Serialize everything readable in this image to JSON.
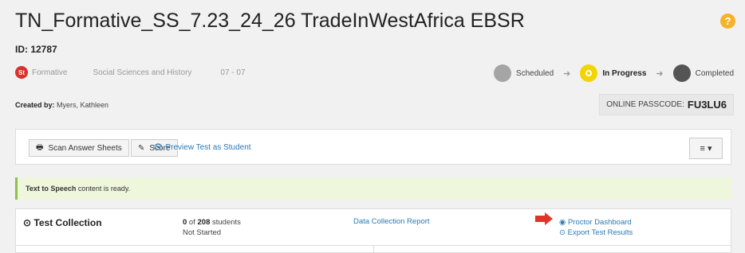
{
  "header": {
    "title": "TN_Formative_SS_7.23_24_26 TradeInWestAfrica EBSR",
    "help_icon": "question-circle-icon",
    "id_text": "ID: 12787"
  },
  "meta": {
    "badge": "St",
    "type": "Formative",
    "subject": "Social Sciences and History",
    "grade": "07 - 07"
  },
  "status_steps": [
    {
      "label": "Scheduled",
      "color": "#a5a5a5"
    },
    {
      "label": "In Progress",
      "color": "#f2d400",
      "active": true
    },
    {
      "label": "Completed",
      "color": "#555555"
    }
  ],
  "created": {
    "label": "Created by:",
    "name": "Myers, Kathleen"
  },
  "passcode": {
    "label": "ONLINE PASSCODE:",
    "code": "FU3LU6"
  },
  "toolbar": {
    "scan_label": "Scan Answer Sheets",
    "score_label": "Score",
    "preview_label": "Preview Test as Student",
    "menu_icon": "hamburger-menu-icon"
  },
  "notice": {
    "bold": "Text to Speech",
    "rest": " content is ready."
  },
  "collection": {
    "title": "Test Collection",
    "count": "0",
    "of_text": " of ",
    "total": "208",
    "students_suffix": " students",
    "status": "Not Started",
    "report_link": "Data Collection Report",
    "proctor_link": "Proctor Dashboard",
    "export_link": "Export Test Results"
  },
  "colors": {
    "accent_link": "#2a7ab8",
    "notice_bg": "#eef6dc",
    "help_icon": "#f5b32c",
    "badge_red": "#d9322b"
  }
}
